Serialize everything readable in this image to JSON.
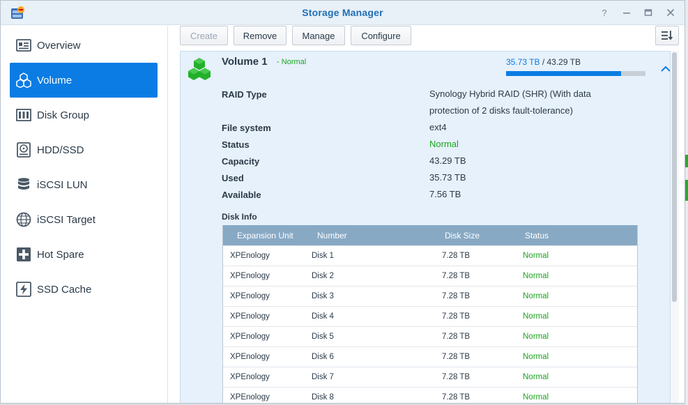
{
  "window": {
    "title": "Storage Manager"
  },
  "sidebar": {
    "items": [
      {
        "label": "Overview",
        "icon": "overview-icon"
      },
      {
        "label": "Volume",
        "icon": "volume-icon",
        "active": true
      },
      {
        "label": "Disk Group",
        "icon": "disk-group-icon"
      },
      {
        "label": "HDD/SSD",
        "icon": "hdd-icon"
      },
      {
        "label": "iSCSI LUN",
        "icon": "iscsi-lun-icon"
      },
      {
        "label": "iSCSI Target",
        "icon": "iscsi-target-icon"
      },
      {
        "label": "Hot Spare",
        "icon": "hot-spare-icon"
      },
      {
        "label": "SSD Cache",
        "icon": "ssd-cache-icon"
      }
    ]
  },
  "toolbar": {
    "create_label": "Create",
    "remove_label": "Remove",
    "manage_label": "Manage",
    "configure_label": "Configure"
  },
  "volume": {
    "name": "Volume 1",
    "status_text": "- Normal",
    "used": "35.73 TB",
    "separator": " / ",
    "total": "43.29 TB",
    "usage_fraction": 0.8254,
    "properties": {
      "raid_type_label": "RAID Type",
      "raid_type_value": "Synology Hybrid RAID (SHR) (With data protection of 2 disks fault-tolerance)",
      "file_system_label": "File system",
      "file_system_value": "ext4",
      "status_label": "Status",
      "status_value": "Normal",
      "capacity_label": "Capacity",
      "capacity_value": "43.29 TB",
      "used_label": "Used",
      "used_value": "35.73 TB",
      "available_label": "Available",
      "available_value": "7.56 TB"
    },
    "disk_info_label": "Disk Info",
    "disk_table": {
      "headers": [
        "Expansion Unit",
        "Number",
        "Disk Size",
        "Status"
      ],
      "rows": [
        [
          "XPEnology",
          "Disk 1",
          "7.28 TB",
          "Normal"
        ],
        [
          "XPEnology",
          "Disk 2",
          "7.28 TB",
          "Normal"
        ],
        [
          "XPEnology",
          "Disk 3",
          "7.28 TB",
          "Normal"
        ],
        [
          "XPEnology",
          "Disk 4",
          "7.28 TB",
          "Normal"
        ],
        [
          "XPEnology",
          "Disk 5",
          "7.28 TB",
          "Normal"
        ],
        [
          "XPEnology",
          "Disk 6",
          "7.28 TB",
          "Normal"
        ],
        [
          "XPEnology",
          "Disk 7",
          "7.28 TB",
          "Normal"
        ],
        [
          "XPEnology",
          "Disk 8",
          "7.28 TB",
          "Normal"
        ]
      ]
    }
  },
  "colors": {
    "accent": "#0a7ce3",
    "status_green": "#1aa51f",
    "title": "#1f6fb5",
    "volume_icon": "#22b02a"
  }
}
